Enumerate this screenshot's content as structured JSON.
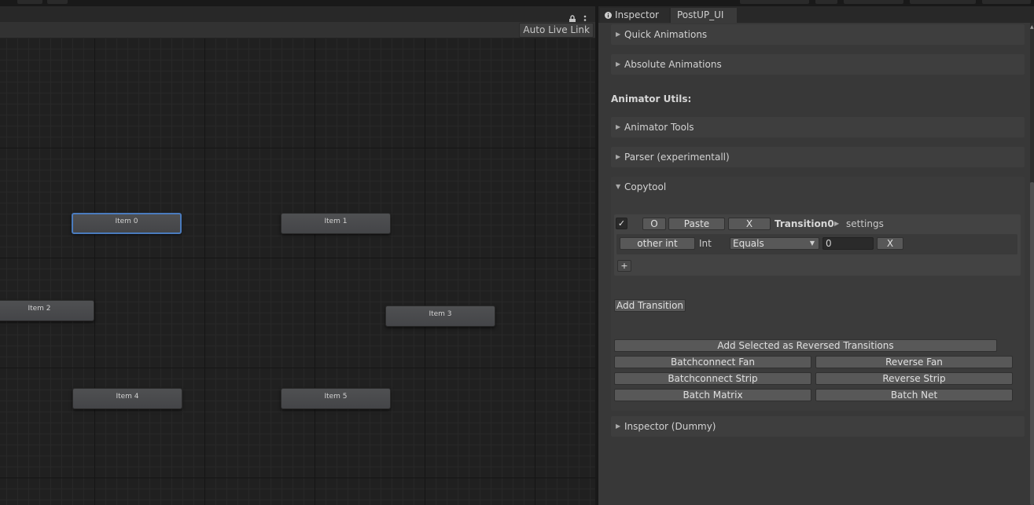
{
  "graph": {
    "auto_live_link_label": "Auto Live Link",
    "nodes": [
      {
        "label": "Item 0",
        "selected": true
      },
      {
        "label": "Item  1",
        "selected": false
      },
      {
        "label": "Item  2",
        "selected": false
      },
      {
        "label": "Item  3",
        "selected": false
      },
      {
        "label": "Item  4",
        "selected": false
      },
      {
        "label": "Item  5",
        "selected": false
      }
    ]
  },
  "inspector": {
    "tabs": [
      {
        "label": "Inspector",
        "icon": "info-icon"
      },
      {
        "label": "PostUP_UI"
      }
    ],
    "foldouts": {
      "quick_animations": "Quick Animations",
      "absolute_animations": "Absolute Animations",
      "animator_tools": "Animator Tools",
      "parser": "Parser (experimentall)",
      "copytool": "Copytool",
      "inspector_dummy": "Inspector (Dummy)"
    },
    "section_title": "Animator Utils:",
    "copytool": {
      "checkbox_mark": "✓",
      "o_label": "O",
      "paste_label": "Paste",
      "x_label": "X",
      "transition_name": "Transition0",
      "settings_label": "settings",
      "condition": {
        "param_label": "other int",
        "type_label": "Int",
        "mode": "Equals",
        "value": "0",
        "remove_label": "X"
      },
      "add_condition_label": "+",
      "add_transition_label": "Add Transition",
      "add_reversed_label": "Add Selected as Reversed Transitions",
      "batch_buttons": [
        "Batchconnect Fan",
        "Reverse Fan",
        "Batchconnect Strip",
        "Reverse Strip",
        "Batch Matrix",
        "Batch Net"
      ]
    }
  },
  "colors": {
    "selection_outline": "#4a7bbd",
    "panel_bg": "#383838",
    "graph_bg": "#202020"
  }
}
